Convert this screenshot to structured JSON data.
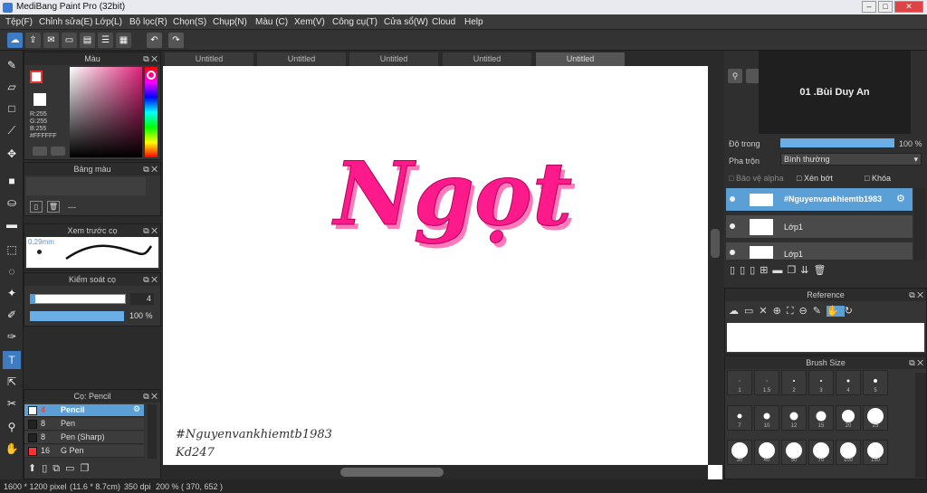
{
  "app": {
    "title": "MediBang Paint Pro (32bit)"
  },
  "menu": [
    "Tệp(F)",
    "Chỉnh sửa(E)",
    "Lớp(L)",
    "Bộ lọc(R)",
    "Chọn(S)",
    "Chụp(N)",
    "Màu (C)",
    "Xem(V)",
    "Công cụ(T)",
    "Cửa sổ(W)",
    "Cloud",
    "Help"
  ],
  "window_controls": [
    "–",
    "□",
    "✕"
  ],
  "doc_tabs": [
    "Untitled",
    "Untitled",
    "Untitled",
    "Untitled",
    "Untitled"
  ],
  "color_panel": {
    "title": "Màu",
    "r": "R:255",
    "g": "G:255",
    "b": "B:255",
    "hex": "#FFFFFF"
  },
  "palette_panel": {
    "title": "Bảng màu",
    "value": "---"
  },
  "preview_panel": {
    "title": "Xem trước cọ",
    "size": "0.29mm"
  },
  "brush_control": {
    "title": "Kiểm soát cọ",
    "size_value": "4",
    "opacity_value": "100 %"
  },
  "brush_panel": {
    "title": "Cọ: Pencil",
    "items": [
      {
        "num": "4",
        "name": "Pencil",
        "color": "#ffffff"
      },
      {
        "num": "8",
        "name": "Pen",
        "color": "#222222"
      },
      {
        "num": "8",
        "name": "Pen (Sharp)",
        "color": "#222222"
      },
      {
        "num": "16",
        "name": "G Pen",
        "color": "#ff3333"
      }
    ]
  },
  "layers": {
    "popup": "01 .Bùi Duy An",
    "opacity_label": "Độ trong",
    "opacity_value": "100 %",
    "blend_label": "Pha trộn",
    "blend_value": "Bình thường",
    "protect_alpha": "Bảo vệ alpha",
    "clip": "Xén bớt",
    "lock": "Khóa",
    "items": [
      "#Nguyenvankhiemtb1983",
      "Lớp1",
      "Lớp1"
    ]
  },
  "reference_panel": {
    "title": "Reference"
  },
  "brush_size_panel": {
    "title": "Brush Size",
    "sizes": [
      "1",
      "1.5",
      "2",
      "3",
      "4",
      "5",
      "7",
      "10",
      "12",
      "15",
      "20",
      "25",
      "30",
      "40",
      "50",
      "70",
      "100",
      "150"
    ]
  },
  "canvas": {
    "art_text": "Ngọt",
    "sign1": "#Nguyenvankhiemtb1983",
    "sign2": "Kd247"
  },
  "status": {
    "size": "1600 * 1200 pixel",
    "cm": "(11.6 * 8.7cm)",
    "dpi": "350 dpi",
    "zoom": "200 %",
    "coords": "( 370, 652 )"
  },
  "colors": {
    "accent": "#5a9fd6",
    "art": "#ff1a8c"
  }
}
